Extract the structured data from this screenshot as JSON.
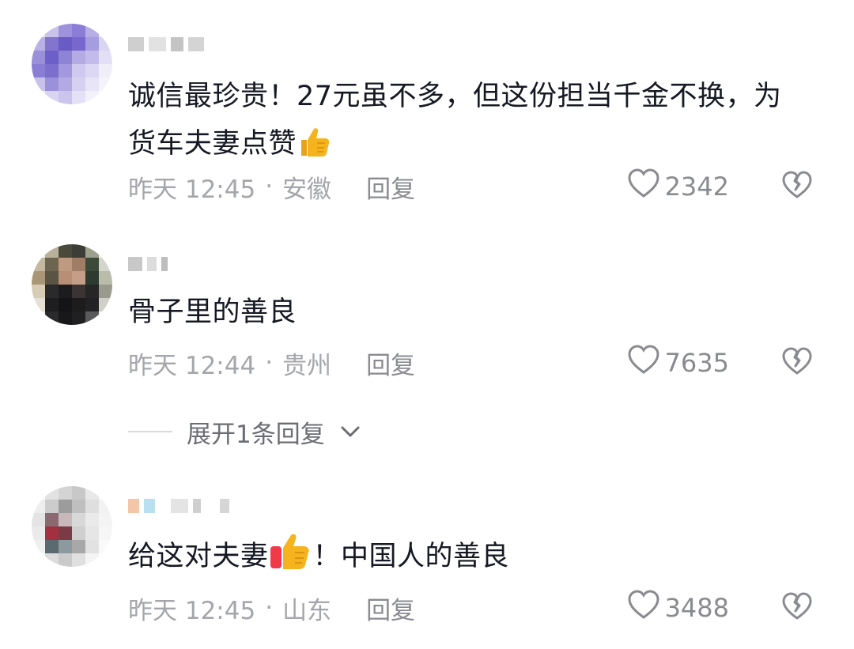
{
  "comments": [
    {
      "text_part1": "诚信最珍贵！27元虽不多，但这份担当千金不换，为货车夫妻点赞",
      "emoji": "thumbs-up-icon",
      "time": "昨天 12:45",
      "location": "安徽",
      "reply_label": "回复",
      "likes": "2342"
    },
    {
      "text_part1": "骨子里的善良",
      "time": "昨天 12:44",
      "location": "贵州",
      "reply_label": "回复",
      "likes": "7635"
    },
    {
      "text_part1": "给这对夫妻",
      "emoji": "thumbs-up-icon",
      "text_part2": "！中国人的善良",
      "time": "昨天 12:45",
      "location": "山东",
      "reply_label": "回复",
      "likes": "3488"
    }
  ],
  "expand_replies_label": "展开1条回复",
  "meta_separator": "·",
  "colors": {
    "text": "#161823",
    "meta": "#a4a6ab",
    "thumb_yellow": "#f5b41e",
    "thumb_red": "#f03a4a"
  }
}
